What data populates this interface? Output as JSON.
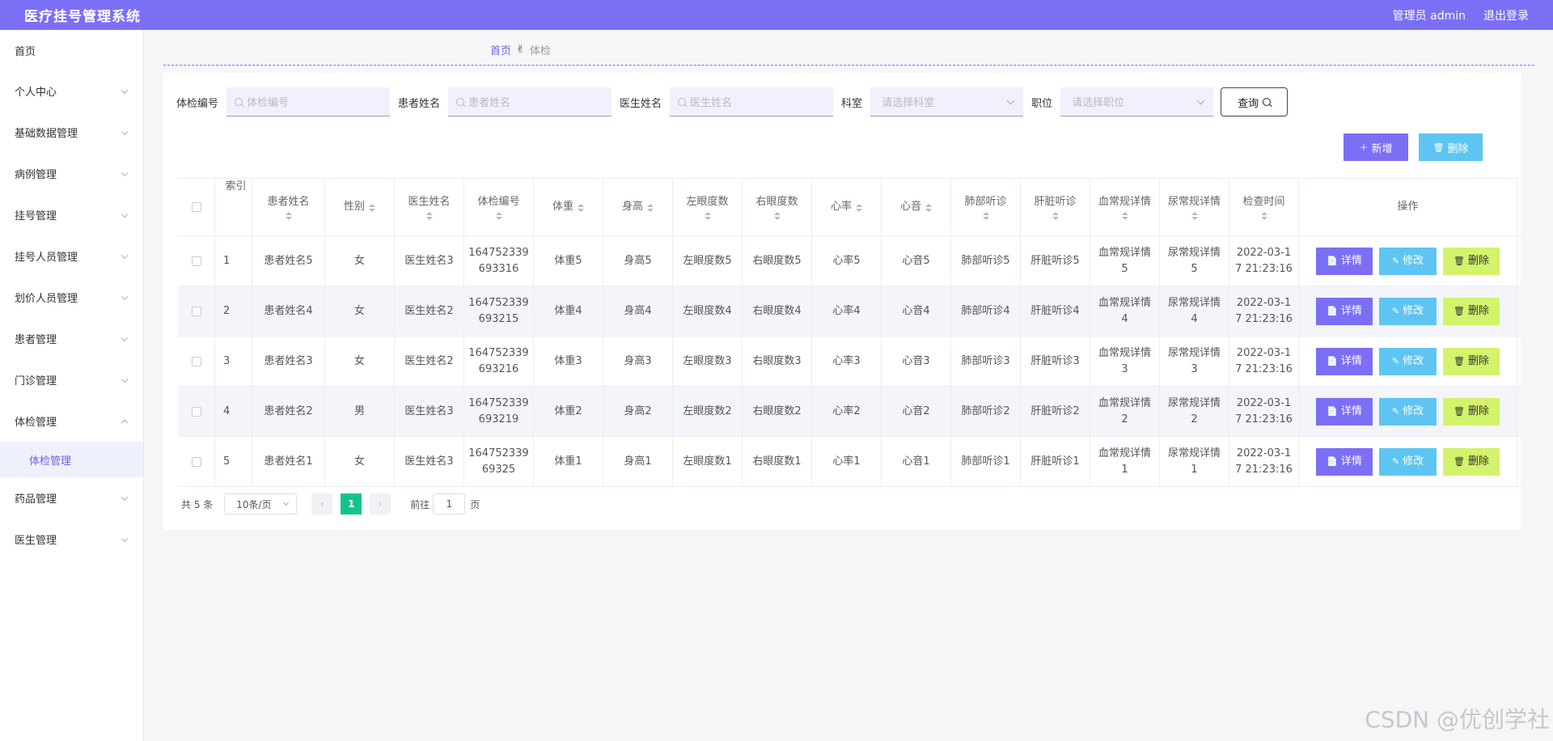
{
  "app": {
    "title": "医疗挂号管理系统",
    "user": "管理员 admin",
    "logout": "退出登录"
  },
  "sidebar": {
    "items": [
      {
        "label": "首页"
      },
      {
        "label": "个人中心"
      },
      {
        "label": "基础数据管理"
      },
      {
        "label": "病例管理"
      },
      {
        "label": "挂号管理"
      },
      {
        "label": "挂号人员管理"
      },
      {
        "label": "划价人员管理"
      },
      {
        "label": "患者管理"
      },
      {
        "label": "门诊管理"
      },
      {
        "label": "体检管理"
      },
      {
        "label": "药品管理"
      },
      {
        "label": "医生管理"
      }
    ],
    "active_sub": "体检管理"
  },
  "breadcrumb": {
    "home": "首页",
    "current": "体检"
  },
  "search": {
    "exam_no_label": "体检编号",
    "exam_no_placeholder": "体检编号",
    "patient_label": "患者姓名",
    "patient_placeholder": "患者姓名",
    "doctor_label": "医生姓名",
    "doctor_placeholder": "医生姓名",
    "dept_label": "科室",
    "dept_placeholder": "请选择科室",
    "title_label": "职位",
    "title_placeholder": "请选择职位",
    "query": "查询"
  },
  "actions": {
    "add": "新增",
    "delete": "删除"
  },
  "table": {
    "headers": [
      "索引",
      "患者姓名",
      "性别",
      "医生姓名",
      "体检编号",
      "体重",
      "身高",
      "左眼度数",
      "右眼度数",
      "心率",
      "心音",
      "肺部听诊",
      "肝脏听诊",
      "血常规详情",
      "尿常规详情",
      "检查时间",
      "操作"
    ],
    "rows": [
      {
        "idx": "1",
        "patient": "患者姓名5",
        "gender": "女",
        "doctor": "医生姓名3",
        "exam_no": "164752339\n693316",
        "weight": "体重5",
        "height": "身高5",
        "left_eye": "左眼度数5",
        "right_eye": "右眼度数5",
        "hr": "心率5",
        "hs": "心音5",
        "lung": "肺部听诊5",
        "liver": "肝脏听诊5",
        "blood": "血常规详情\n5",
        "urine": "尿常规详情\n5",
        "time": "2022-03-1\n7 21:23:16"
      },
      {
        "idx": "2",
        "patient": "患者姓名4",
        "gender": "女",
        "doctor": "医生姓名2",
        "exam_no": "164752339\n693215",
        "weight": "体重4",
        "height": "身高4",
        "left_eye": "左眼度数4",
        "right_eye": "右眼度数4",
        "hr": "心率4",
        "hs": "心音4",
        "lung": "肺部听诊4",
        "liver": "肝脏听诊4",
        "blood": "血常规详情\n4",
        "urine": "尿常规详情\n4",
        "time": "2022-03-1\n7 21:23:16"
      },
      {
        "idx": "3",
        "patient": "患者姓名3",
        "gender": "女",
        "doctor": "医生姓名2",
        "exam_no": "164752339\n693216",
        "weight": "体重3",
        "height": "身高3",
        "left_eye": "左眼度数3",
        "right_eye": "右眼度数3",
        "hr": "心率3",
        "hs": "心音3",
        "lung": "肺部听诊3",
        "liver": "肝脏听诊3",
        "blood": "血常规详情\n3",
        "urine": "尿常规详情\n3",
        "time": "2022-03-1\n7 21:23:16"
      },
      {
        "idx": "4",
        "patient": "患者姓名2",
        "gender": "男",
        "doctor": "医生姓名3",
        "exam_no": "164752339\n693219",
        "weight": "体重2",
        "height": "身高2",
        "left_eye": "左眼度数2",
        "right_eye": "右眼度数2",
        "hr": "心率2",
        "hs": "心音2",
        "lung": "肺部听诊2",
        "liver": "肝脏听诊2",
        "blood": "血常规详情\n2",
        "urine": "尿常规详情\n2",
        "time": "2022-03-1\n7 21:23:16"
      },
      {
        "idx": "5",
        "patient": "患者姓名1",
        "gender": "女",
        "doctor": "医生姓名3",
        "exam_no": "164752339\n69325",
        "weight": "体重1",
        "height": "身高1",
        "left_eye": "左眼度数1",
        "right_eye": "右眼度数1",
        "hr": "心率1",
        "hs": "心音1",
        "lung": "肺部听诊1",
        "liver": "肝脏听诊1",
        "blood": "血常规详情\n1",
        "urine": "尿常规详情\n1",
        "time": "2022-03-1\n7 21:23:16"
      }
    ],
    "op_labels": {
      "detail": "详情",
      "edit": "修改",
      "remove": "删除"
    }
  },
  "pagination": {
    "total": "共 5 条",
    "page_size": "10条/页",
    "current_page": "1",
    "goto_label": "前往",
    "goto_value": "1",
    "page_suffix": "页"
  },
  "watermark": "CSDN @优创学社",
  "colors": {
    "primary": "#7b6ff5",
    "info": "#5ec5f2",
    "warn": "#d2f36b",
    "page_active": "#13c48a"
  },
  "icons": {
    "search": "search-icon",
    "plus": "plus-icon",
    "trash": "trash-icon",
    "doc": "document-icon",
    "pen": "edit-icon",
    "hand": "hand-icon"
  }
}
